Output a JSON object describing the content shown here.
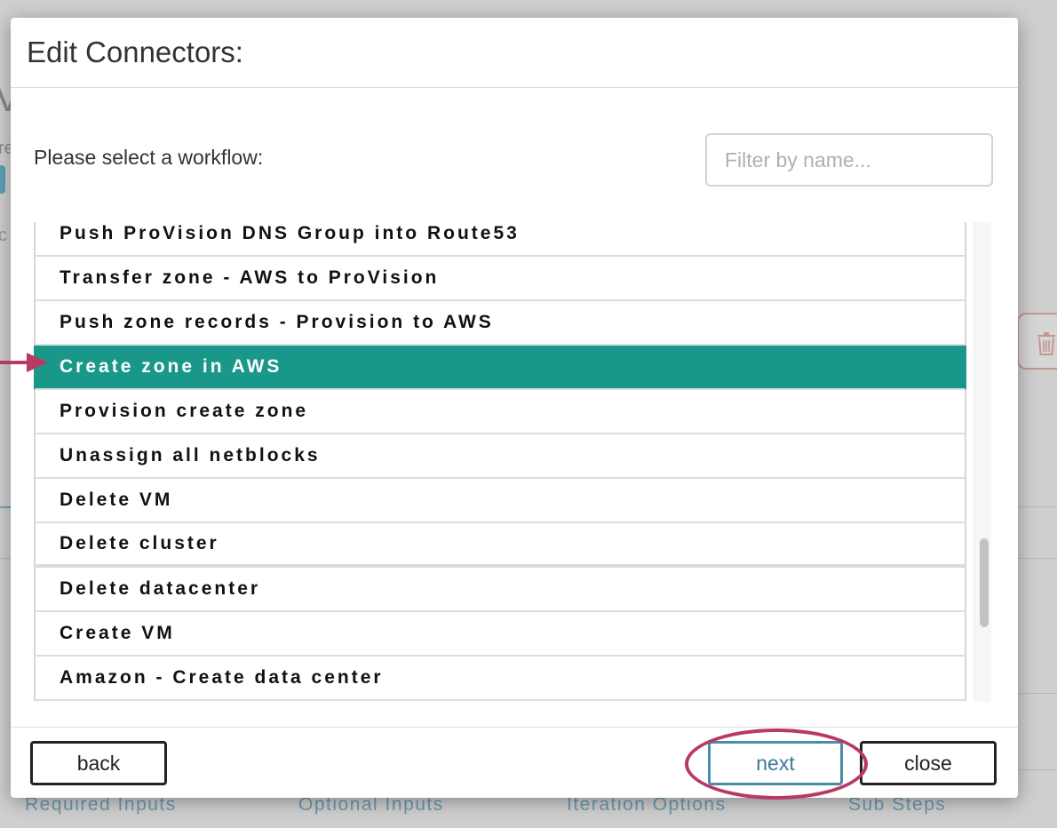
{
  "colors": {
    "accent_selected": "#19988a",
    "annotation": "#b83a63",
    "next_button": "#4a8cab"
  },
  "background": {
    "partial_title": "V",
    "partial_text_1": "re",
    "partial_text_2": "c",
    "tabs": [
      "Required Inputs",
      "Optional Inputs",
      "Iteration Options",
      "Sub Steps"
    ],
    "trash_icon": "trash-icon"
  },
  "modal": {
    "title": "Edit Connectors:",
    "prompt": "Please select a workflow:",
    "filter": {
      "placeholder": "Filter by name...",
      "value": ""
    },
    "workflows": [
      {
        "label": "Push ProVision DNS Group into Route53",
        "selected": false
      },
      {
        "label": "Transfer zone - AWS to ProVision",
        "selected": false
      },
      {
        "label": "Push zone records - Provision to AWS",
        "selected": false
      },
      {
        "label": "Create zone in AWS",
        "selected": true
      },
      {
        "label": "Provision create zone",
        "selected": false
      },
      {
        "label": "Unassign all netblocks",
        "selected": false
      },
      {
        "label": "Delete VM",
        "selected": false
      },
      {
        "label": "Delete cluster",
        "selected": false
      },
      {
        "label": "Delete datacenter",
        "selected": false
      },
      {
        "label": "Create VM",
        "selected": false
      },
      {
        "label": "Amazon - Create data center",
        "selected": false
      }
    ],
    "footer": {
      "back_label": "back",
      "next_label": "next",
      "close_label": "close"
    }
  }
}
